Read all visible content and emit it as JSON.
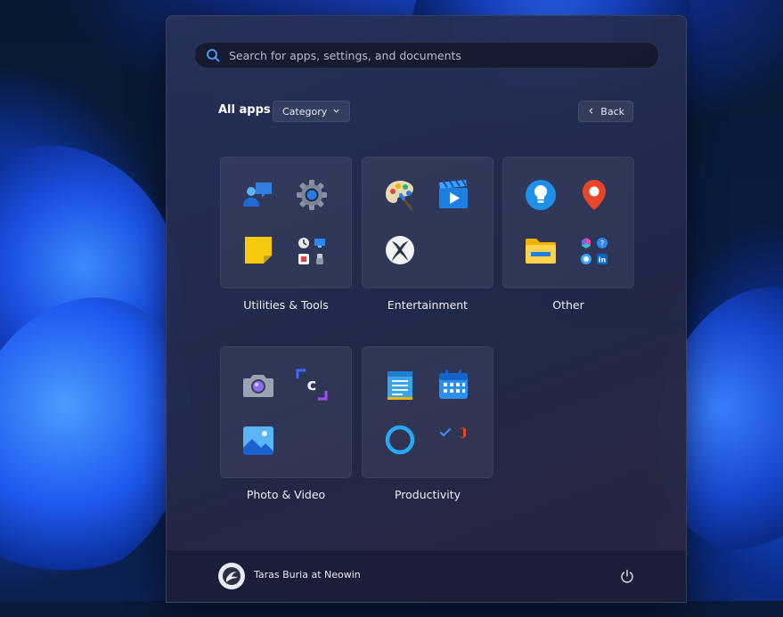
{
  "search": {
    "placeholder": "Search for apps, settings, and documents",
    "icon": "search-icon"
  },
  "header": {
    "all_apps_label": "All apps",
    "category_label": "Category",
    "back_label": "Back"
  },
  "categories": [
    {
      "label": "Utilities & Tools",
      "icons": [
        "people-chat-icon",
        "settings-gear-icon",
        "sticky-notes-icon",
        "mini-apps-folder-icon"
      ]
    },
    {
      "label": "Entertainment",
      "icons": [
        "paint-palette-icon",
        "video-clapper-icon",
        "xbox-icon"
      ]
    },
    {
      "label": "Other",
      "icons": [
        "tips-lightbulb-icon",
        "maps-pin-icon",
        "file-explorer-folder-icon",
        "mini-apps-folder-icon"
      ]
    },
    {
      "label": "Photo & Video",
      "icons": [
        "camera-icon",
        "clipchamp-icon",
        "photos-icon"
      ]
    },
    {
      "label": "Productivity",
      "icons": [
        "notepad-icon",
        "calendar-icon",
        "cortana-ring-icon",
        "mini-apps-folder-icon"
      ]
    }
  ],
  "footer": {
    "user_name": "Taras Buria at Neowin",
    "power_icon": "power-icon"
  },
  "colors": {
    "accent": "#1f6fe5",
    "panel": "#262f55"
  }
}
